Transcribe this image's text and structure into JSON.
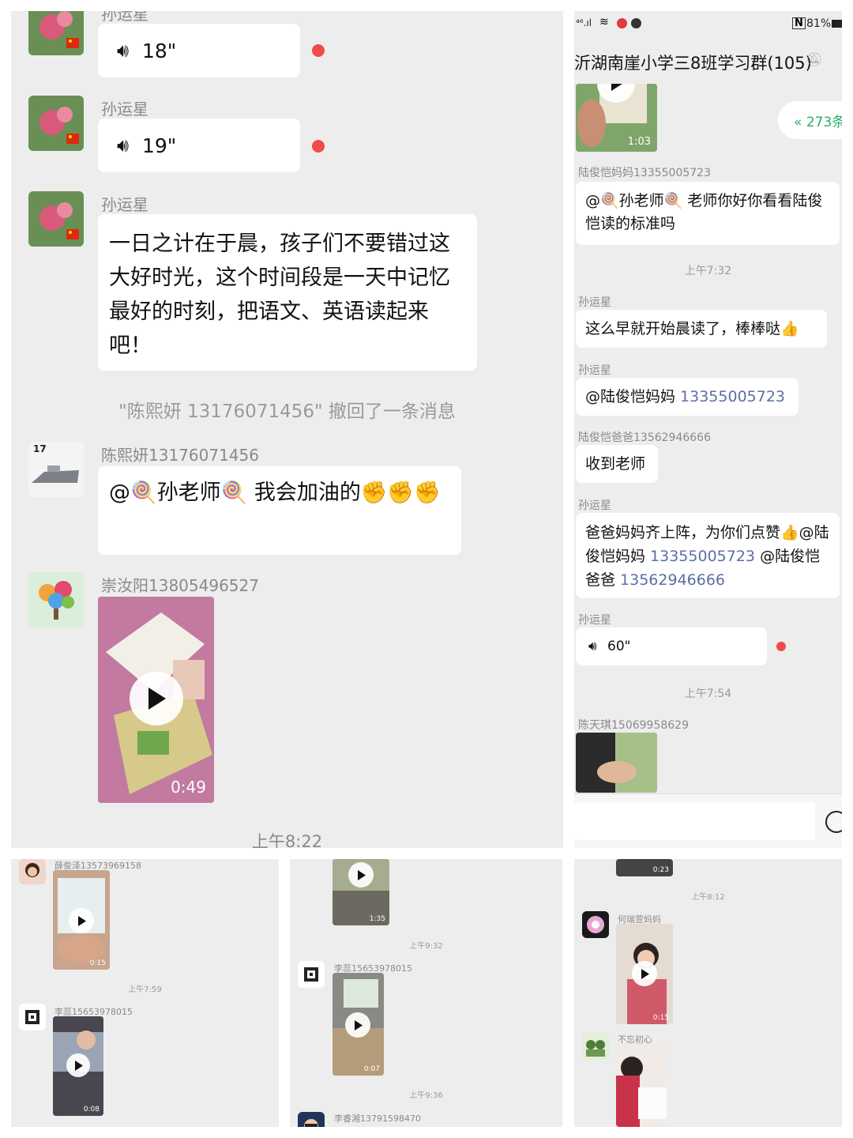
{
  "panel_main": {
    "top_name": "孙运星",
    "messages": [
      {
        "sender": "孙运星",
        "voice": "18\""
      },
      {
        "sender": "孙运星",
        "voice": "19\""
      },
      {
        "sender": "孙运星",
        "text": "一日之计在于晨，孩子们不要错过这大好时光，这个时间段是一天中记忆最好的时刻，把语文、英语读起来吧！"
      }
    ],
    "recall_notice": "\"陈熙妍 13176071456\" 撤回了一条消息",
    "chen_name": "陈熙妍13176071456",
    "chen_avatar_num": "17",
    "chen_text": "@🍭孙老师🍭  我会加油的✊✊✊",
    "chong_name": "崇汝阳13805496527",
    "chong_video_duration": "0:49",
    "bottom_time": "上午8:22"
  },
  "panel_right": {
    "status": {
      "signal": "⁴⁶.ıl",
      "nfc": "N",
      "battery": "81%"
    },
    "title": "沂湖南崖小学三8班学习群(105)",
    "unread_pill": "273条",
    "video1_duration": "1:03",
    "msgs": [
      {
        "sender": "陆俊恺妈妈13355005723",
        "text": "@🍭孙老师🍭  老师你好你看看陆俊恺读的标准吗"
      },
      {
        "time": "上午7:32"
      },
      {
        "sender": "孙运星",
        "text": "这么早就开始晨读了，棒棒哒👍"
      },
      {
        "sender": "孙运星",
        "prefix": "@陆俊恺妈妈 ",
        "link": "13355005723"
      },
      {
        "sender": "陆俊恺爸爸13562946666",
        "text": "收到老师"
      },
      {
        "sender": "孙运星",
        "p1": "爸爸妈妈齐上阵，为你们点赞👍@陆俊恺妈妈 ",
        "l1": "13355005723",
        "p2": " @陆俊恺爸爸 ",
        "l2": "13562946666"
      },
      {
        "sender": "孙运星",
        "voice": "60\""
      },
      {
        "time": "上午7:54"
      },
      {
        "sender": "陈天琪15069958629"
      }
    ]
  },
  "panel_b1": {
    "name1": "薛俊泽13573969158",
    "dur1": "0:15",
    "time": "上午7:59",
    "name2": "李蕊15653978015",
    "dur2": "0:08"
  },
  "panel_b2": {
    "dur1": "1:35",
    "time1": "上午9:32",
    "name1": "李蕊15653978015",
    "dur2": "0:07",
    "time2": "上午9:36",
    "name2": "李睿湘13791598470"
  },
  "panel_b3": {
    "dur0": "0:23",
    "time": "上午8:12",
    "name1": "何瑞萱妈妈",
    "dur1": "0:15",
    "name2": "不忘初心"
  },
  "colors": {
    "bg": "#ededed",
    "bubble": "#ffffff",
    "unread_dot": "#f04a4a",
    "link": "#5b6fa6",
    "green": "#2aae67"
  }
}
